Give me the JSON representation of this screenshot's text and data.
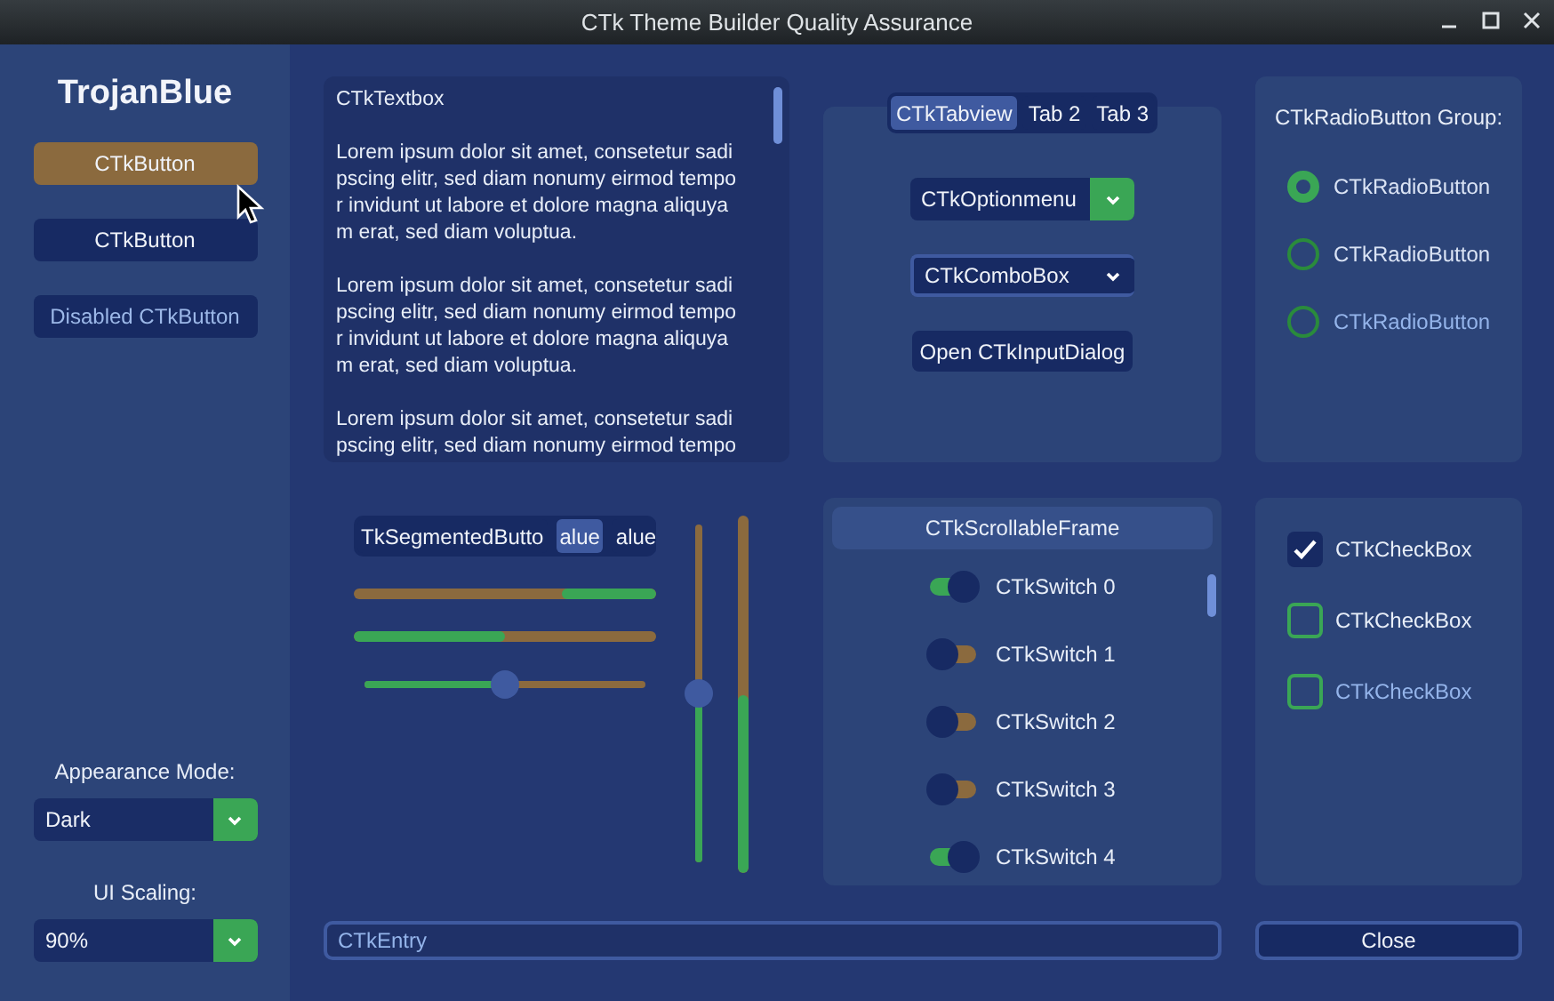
{
  "window": {
    "title": "CTk Theme Builder Quality Assurance"
  },
  "sidebar": {
    "title": "TrojanBlue",
    "buttons": [
      {
        "label": "CTkButton",
        "hovered": true,
        "disabled": false
      },
      {
        "label": "CTkButton",
        "hovered": false,
        "disabled": false
      },
      {
        "label": "Disabled CTkButton",
        "hovered": false,
        "disabled": true
      }
    ],
    "appearance_label": "Appearance Mode:",
    "appearance_value": "Dark",
    "scaling_label": "UI Scaling:",
    "scaling_value": "90%"
  },
  "textbox": {
    "paragraphs": [
      [
        "CTkTextbox"
      ],
      [
        "Lorem ipsum dolor sit amet, consetetur sadi",
        "pscing elitr, sed diam nonumy eirmod tempo",
        "r invidunt ut labore et dolore magna aliquya",
        "m erat, sed diam voluptua."
      ],
      [
        "Lorem ipsum dolor sit amet, consetetur sadi",
        "pscing elitr, sed diam nonumy eirmod tempo",
        "r invidunt ut labore et dolore magna aliquya",
        "m erat, sed diam voluptua."
      ],
      [
        "Lorem ipsum dolor sit amet, consetetur sadi",
        "pscing elitr, sed diam nonumy eirmod tempo"
      ]
    ]
  },
  "tabview": {
    "tabs": [
      {
        "label": "CTkTabview",
        "selected": true
      },
      {
        "label": "Tab 2",
        "selected": false
      },
      {
        "label": "Tab 3",
        "selected": false
      }
    ],
    "option_menu": {
      "value": "CTkOptionmenu"
    },
    "combo_box": {
      "value": "CTkComboBox"
    },
    "dialog_button": "Open CTkInputDialog"
  },
  "radio_group": {
    "title": "CTkRadioButton Group:",
    "items": [
      {
        "label": "CTkRadioButton",
        "selected": true,
        "disabled": false
      },
      {
        "label": "CTkRadioButton",
        "selected": false,
        "disabled": false
      },
      {
        "label": "CTkRadioButton",
        "selected": false,
        "disabled": true
      }
    ]
  },
  "segmented_button": {
    "segments": [
      {
        "label": "TkSegmentedButto",
        "selected": false
      },
      {
        "label": "alue",
        "selected": true
      },
      {
        "label": "alue",
        "selected": false
      }
    ]
  },
  "progress_bars": [
    {
      "kind": "indeterminate",
      "level": 0.31
    },
    {
      "kind": "determinate",
      "level": 0.5
    }
  ],
  "slider": {
    "level": 0.5
  },
  "vertical_slider": {
    "level": 0.5
  },
  "vertical_progress": {
    "level": 0.5
  },
  "scrollable_frame": {
    "title": "CTkScrollableFrame",
    "switches": [
      {
        "label": "CTkSwitch 0",
        "on": true
      },
      {
        "label": "CTkSwitch 1",
        "on": false
      },
      {
        "label": "CTkSwitch 2",
        "on": false
      },
      {
        "label": "CTkSwitch 3",
        "on": false
      },
      {
        "label": "CTkSwitch 4",
        "on": true
      }
    ]
  },
  "checkboxes": [
    {
      "label": "CTkCheckBox",
      "checked": true,
      "disabled": false
    },
    {
      "label": "CTkCheckBox",
      "checked": false,
      "disabled": false
    },
    {
      "label": "CTkCheckBox",
      "checked": false,
      "disabled": true
    }
  ],
  "entry": {
    "placeholder": "CTkEntry"
  },
  "close_button": "Close"
}
